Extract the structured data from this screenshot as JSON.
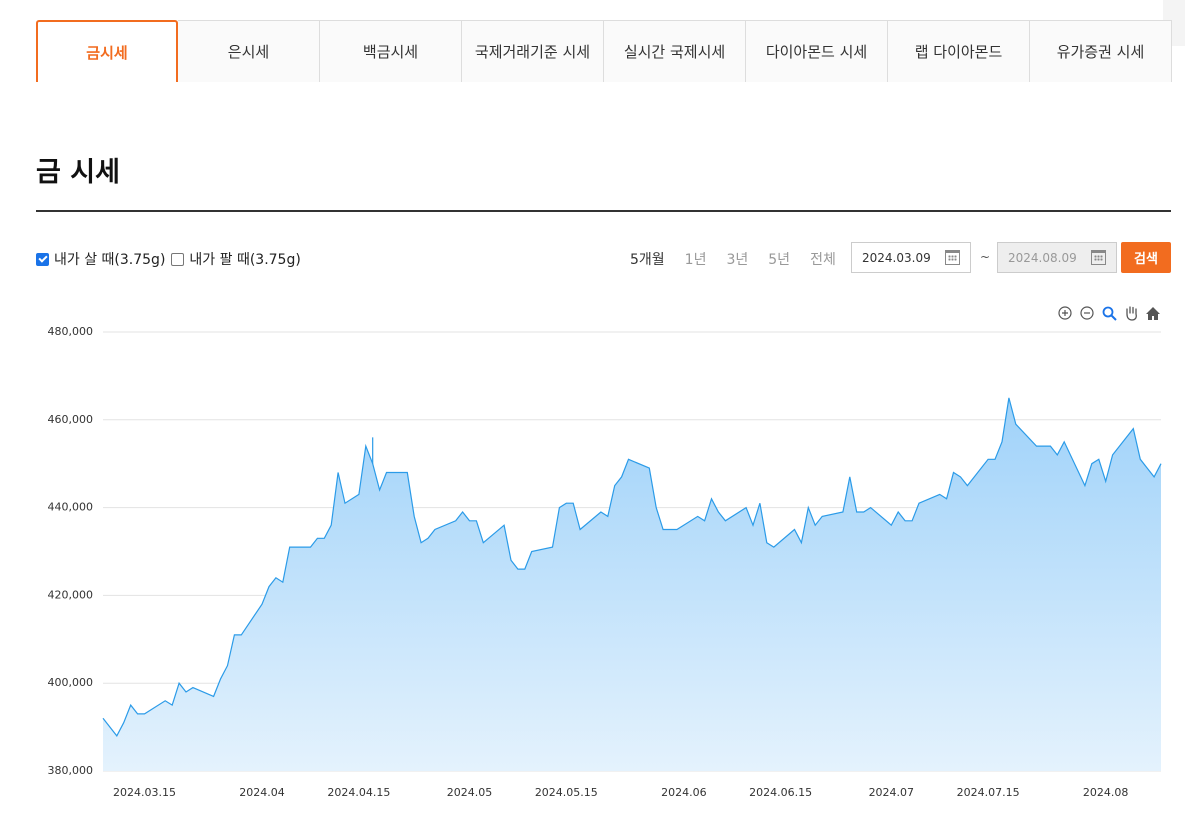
{
  "tabs": [
    "금시세",
    "은시세",
    "백금시세",
    "국제거래기준 시세",
    "실시간 국제시세",
    "다이아몬드 시세",
    "랩 다이아몬드",
    "유가증권 시세"
  ],
  "page_title": "금 시세",
  "filters": {
    "buy_label": "내가 살 때(3.75g)",
    "buy_checked": true,
    "sell_label": "내가 팔 때(3.75g)",
    "sell_checked": false
  },
  "periods": [
    "5개월",
    "1년",
    "3년",
    "5년",
    "전체"
  ],
  "active_period": "5개월",
  "date_from": "2024.03.09",
  "date_sep": "~",
  "date_to": "2024.08.09",
  "search_label": "검색",
  "colors": {
    "accent": "#f26c1f",
    "line": "#2b9be8",
    "fill_top": "#9fd2f9",
    "fill_bottom": "#e4f2fd"
  },
  "toolbar_icons": [
    "zoom-in-icon",
    "zoom-out-icon",
    "magnifier-icon",
    "pan-hand-icon",
    "home-icon"
  ],
  "chart_data": {
    "type": "area",
    "title": "",
    "xlabel": "",
    "ylabel": "",
    "ylim": [
      380000,
      480000
    ],
    "yticks": [
      380000,
      400000,
      420000,
      440000,
      460000,
      480000
    ],
    "ytick_labels": [
      "380,000",
      "400,000",
      "420,000",
      "440,000",
      "460,000",
      "480,000"
    ],
    "xticks": [
      "2024-03-15",
      "2024-04-01",
      "2024-04-15",
      "2024-05-01",
      "2024-05-15",
      "2024-06-01",
      "2024-06-15",
      "2024-07-01",
      "2024-07-15",
      "2024-08-01"
    ],
    "xtick_labels": [
      "2024.03.15",
      "2024.04",
      "2024.04.15",
      "2024.05",
      "2024.05.15",
      "2024.06",
      "2024.06.15",
      "2024.07",
      "2024.07.15",
      "2024.08"
    ],
    "xlim": [
      "2024-03-09",
      "2024-08-09"
    ],
    "grid": true,
    "legend": "none",
    "series": [
      {
        "x": [
          "2024-03-09",
          "2024-03-11",
          "2024-03-12",
          "2024-03-13",
          "2024-03-14",
          "2024-03-15",
          "2024-03-18",
          "2024-03-19",
          "2024-03-20",
          "2024-03-21",
          "2024-03-22",
          "2024-03-25",
          "2024-03-26",
          "2024-03-27",
          "2024-03-28",
          "2024-03-29",
          "2024-04-01",
          "2024-04-02",
          "2024-04-03",
          "2024-04-04",
          "2024-04-05",
          "2024-04-08",
          "2024-04-09",
          "2024-04-10",
          "2024-04-11",
          "2024-04-12",
          "2024-04-13",
          "2024-04-15",
          "2024-04-16",
          "2024-04-17",
          "2024-04-18",
          "2024-04-19",
          "2024-04-22",
          "2024-04-23",
          "2024-04-24",
          "2024-04-25",
          "2024-04-26",
          "2024-04-29",
          "2024-04-30",
          "2024-05-01",
          "2024-05-02",
          "2024-05-03",
          "2024-05-06",
          "2024-05-07",
          "2024-05-08",
          "2024-05-09",
          "2024-05-10",
          "2024-05-13",
          "2024-05-14",
          "2024-05-15",
          "2024-05-16",
          "2024-05-17",
          "2024-05-20",
          "2024-05-21",
          "2024-05-22",
          "2024-05-23",
          "2024-05-24",
          "2024-05-27",
          "2024-05-28",
          "2024-05-29",
          "2024-05-30",
          "2024-05-31",
          "2024-06-03",
          "2024-06-04",
          "2024-06-05",
          "2024-06-06",
          "2024-06-07",
          "2024-06-10",
          "2024-06-11",
          "2024-06-12",
          "2024-06-13",
          "2024-06-14",
          "2024-06-17",
          "2024-06-18",
          "2024-06-19",
          "2024-06-20",
          "2024-06-21",
          "2024-06-24",
          "2024-06-25",
          "2024-06-26",
          "2024-06-27",
          "2024-06-28",
          "2024-07-01",
          "2024-07-02",
          "2024-07-03",
          "2024-07-04",
          "2024-07-05",
          "2024-07-08",
          "2024-07-09",
          "2024-07-10",
          "2024-07-11",
          "2024-07-12",
          "2024-07-15",
          "2024-07-16",
          "2024-07-17",
          "2024-07-18",
          "2024-07-19",
          "2024-07-22",
          "2024-07-23",
          "2024-07-24",
          "2024-07-25",
          "2024-07-26",
          "2024-07-29",
          "2024-07-30",
          "2024-07-31",
          "2024-08-01",
          "2024-08-02",
          "2024-08-05",
          "2024-08-06",
          "2024-08-07",
          "2024-08-08",
          "2024-08-09"
        ],
        "values": [
          392000,
          388000,
          391000,
          395000,
          393000,
          393000,
          396000,
          395000,
          400000,
          398000,
          399000,
          397000,
          401000,
          404000,
          411000,
          411000,
          418000,
          422000,
          424000,
          423000,
          431000,
          431000,
          433000,
          433000,
          436000,
          448000,
          441000,
          443000,
          454000,
          450000,
          444000,
          448000,
          448000,
          438000,
          432000,
          433000,
          435000,
          437000,
          439000,
          437000,
          437000,
          432000,
          436000,
          428000,
          426000,
          426000,
          430000,
          431000,
          440000,
          441000,
          441000,
          435000,
          439000,
          438000,
          445000,
          447000,
          451000,
          449000,
          440000,
          435000,
          435000,
          435000,
          438000,
          437000,
          442000,
          439000,
          437000,
          440000,
          436000,
          441000,
          432000,
          431000,
          435000,
          432000,
          440000,
          436000,
          438000,
          439000,
          447000,
          439000,
          439000,
          440000,
          436000,
          439000,
          437000,
          437000,
          441000,
          443000,
          442000,
          448000,
          447000,
          445000,
          451000,
          451000,
          455000,
          465000,
          459000,
          454000,
          454000,
          454000,
          452000,
          455000,
          445000,
          450000,
          451000,
          446000,
          452000,
          458000,
          451000,
          449000,
          447000,
          450000
        ],
        "spikes": [
          {
            "x": "2024-04-17",
            "value": 456000
          }
        ]
      }
    ]
  }
}
